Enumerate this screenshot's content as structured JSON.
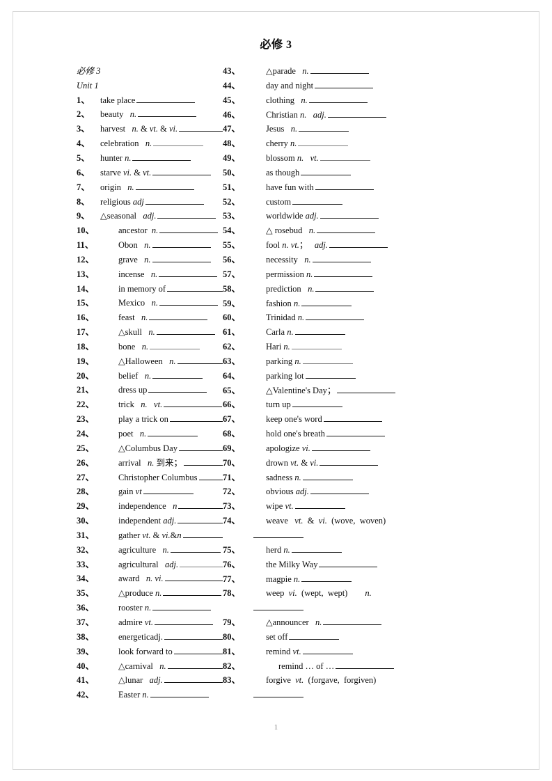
{
  "header": {
    "running_title": "必修 3",
    "page_number": "1"
  },
  "left_column": {
    "book_label": "必修 3",
    "unit_label": "Unit 1",
    "entries": [
      {
        "num": "1、",
        "text": "take place",
        "blank": "l"
      },
      {
        "num": "2、",
        "text": "beauty   n.",
        "blank": "l"
      },
      {
        "num": "3、",
        "text": "harvest   n. & vt. & vi.",
        "blank": "l"
      },
      {
        "num": "4、",
        "text": "celebration   n.",
        "blank": "m",
        "faint": true
      },
      {
        "num": "5、",
        "text": "hunter n.",
        "blank": "l"
      },
      {
        "num": "6、",
        "text": "starve vi. & vt.",
        "blank": "l"
      },
      {
        "num": "7、",
        "text": "origin   n.",
        "blank": "l"
      },
      {
        "num": "8、",
        "text": "religious adj",
        "blank": "l"
      },
      {
        "num": "9、",
        "text": "△seasonal   adj.",
        "blank": "l"
      },
      {
        "num": "10、",
        "text": "ancestor  n.",
        "blank": "l"
      },
      {
        "num": "11、",
        "text": "Obon   n.",
        "blank": "l"
      },
      {
        "num": "12、",
        "text": "grave   n.",
        "blank": "l"
      },
      {
        "num": "13、",
        "text": "incense   n.",
        "blank": "l"
      },
      {
        "num": "14、",
        "text": "in memory of",
        "blank": "l"
      },
      {
        "num": "15、",
        "text": "Mexico   n.",
        "blank": "l"
      },
      {
        "num": "16、",
        "text": "feast   n.",
        "blank": "l"
      },
      {
        "num": "17、",
        "text": "△skull   n.",
        "blank": "l"
      },
      {
        "num": "18、",
        "text": "bone   n.",
        "blank": "m",
        "faint": true
      },
      {
        "num": "19、",
        "text": "△Halloween   n.",
        "blank": "l"
      },
      {
        "num": "20、",
        "text": "belief   n.",
        "blank": "m"
      },
      {
        "num": "21、",
        "text": "dress up",
        "blank": "l"
      },
      {
        "num": "22、",
        "text": "trick   n.   vt.",
        "blank": "l"
      },
      {
        "num": "23、",
        "text": "play a trick on",
        "blank": "l"
      },
      {
        "num": "24、",
        "text": "poet   n.",
        "blank": "m"
      },
      {
        "num": "25、",
        "text": "△Columbus Day",
        "blank": "l"
      },
      {
        "num": "26、",
        "text": "arrival   n. 到来；",
        "blank": "l"
      },
      {
        "num": "27、",
        "text": "Christopher Columbus",
        "blank": "m"
      },
      {
        "num": "28、",
        "text": "gain vt",
        "blank": "m"
      },
      {
        "num": "29、",
        "text": "independence   n",
        "blank": "l"
      },
      {
        "num": "30、",
        "text": "independent adj.",
        "blank": "l"
      },
      {
        "num": "31、",
        "text": "gather vt. & vi.&n",
        "blank": "m",
        "after": "."
      },
      {
        "num": "32、",
        "text": "agriculture   n.",
        "blank": "m"
      },
      {
        "num": "33、",
        "text": "agricultural   adj.",
        "blank": "m",
        "faint": true
      },
      {
        "num": "34、",
        "text": "award   n. vi.",
        "blank": "l"
      },
      {
        "num": "35、",
        "text": "△produce n.",
        "blank": "l"
      },
      {
        "num": "36、",
        "text": "rooster n.",
        "blank": "l"
      },
      {
        "num": "37、",
        "text": "admire vt.",
        "blank": "l"
      },
      {
        "num": "38、",
        "text": "energeticadj.",
        "blank": "l"
      },
      {
        "num": "39、",
        "text": "look forward to",
        "blank": "l"
      },
      {
        "num": "40、",
        "text": "△carnival   n.",
        "blank": "l"
      },
      {
        "num": "41、",
        "text": "△lunar   adj.",
        "blank": "l"
      },
      {
        "num": "42、",
        "text": "Easter n.",
        "blank": "l"
      }
    ]
  },
  "right_column": {
    "entries": [
      {
        "num": "43、",
        "text": "△parade   n.",
        "blank": "l"
      },
      {
        "num": "44、",
        "text": "day and night",
        "blank": "l"
      },
      {
        "num": "45、",
        "text": "clothing   n.",
        "blank": "l"
      },
      {
        "num": "46、",
        "text": "Christian n.   adj.",
        "blank": "l"
      },
      {
        "num": "47、",
        "text": "Jesus   n.",
        "blank": "m"
      },
      {
        "num": "48、",
        "text": "cherry n.",
        "blank": "m",
        "faint": true
      },
      {
        "num": "49、",
        "text": "blossom n.   vt.",
        "blank": "m",
        "faint": true
      },
      {
        "num": "50、",
        "text": "as though",
        "blank": "m"
      },
      {
        "num": "51、",
        "text": "have fun with",
        "blank": "l"
      },
      {
        "num": "52、",
        "text": "custom",
        "blank": "m"
      },
      {
        "num": "53、",
        "text": "worldwide adj.",
        "blank": "l"
      },
      {
        "num": "54、",
        "text": "△ rosebud   n.",
        "blank": "l"
      },
      {
        "num": "55、",
        "text": "fool n. vt.；   adj.",
        "blank": "l"
      },
      {
        "num": "56、",
        "text": "necessity   n.",
        "blank": "l"
      },
      {
        "num": "57、",
        "text": "permission n.",
        "blank": "l"
      },
      {
        "num": "58、",
        "text": "prediction   n.",
        "blank": "l"
      },
      {
        "num": "59、",
        "text": "fashion n.",
        "blank": "m"
      },
      {
        "num": "60、",
        "text": "Trinidad n.",
        "blank": "l"
      },
      {
        "num": "61、",
        "text": "Carla n.",
        "blank": "m"
      },
      {
        "num": "62、",
        "text": "Hari n.",
        "blank": "m",
        "faint": true
      },
      {
        "num": "63、",
        "text": "parking n.",
        "blank": "m",
        "faint": true
      },
      {
        "num": "64、",
        "text": "parking lot",
        "blank": "m"
      },
      {
        "num": "65、",
        "text": "△Valentine's Day；",
        "blank": "l"
      },
      {
        "num": "66、",
        "text": "turn up",
        "blank": "m"
      },
      {
        "num": "67、",
        "text": "keep one's word",
        "blank": "l"
      },
      {
        "num": "68、",
        "text": "hold one's breath",
        "blank": "l"
      },
      {
        "num": "69、",
        "text": "apologize vi.",
        "blank": "l"
      },
      {
        "num": "70、",
        "text": "drown vt. & vi.",
        "blank": "l"
      },
      {
        "num": "71、",
        "text": "sadness n.",
        "blank": "m"
      },
      {
        "num": "72、",
        "text": "obvious adj.",
        "blank": "l"
      },
      {
        "num": "73、",
        "text": "wipe vt.",
        "blank": "m"
      },
      {
        "num": "74、",
        "text": "weave   vt.  &  vi.  (wove,  woven)",
        "blank": "none",
        "cont": "m"
      },
      {
        "num": "75、",
        "text": "herd n.",
        "blank": "m"
      },
      {
        "num": "76、",
        "text": "the Milky Way",
        "blank": "l"
      },
      {
        "num": "77、",
        "text": "magpie n.",
        "blank": "m"
      },
      {
        "num": "78、",
        "text": "weep  vi.  (wept,  wept)        n.",
        "blank": "none",
        "cont": "m"
      },
      {
        "num": "79、",
        "text": "△announcer   n.",
        "blank": "l"
      },
      {
        "num": "80、",
        "text": "set off",
        "blank": "m"
      },
      {
        "num": "81、",
        "text": "remind vt.",
        "blank": "m"
      },
      {
        "num": "82、",
        "text": "remind … of …",
        "blank": "l",
        "extra_indent": true
      },
      {
        "num": "83、",
        "text": "forgive  vt.  (forgave,  forgiven)",
        "blank": "none",
        "cont": "m"
      }
    ]
  }
}
